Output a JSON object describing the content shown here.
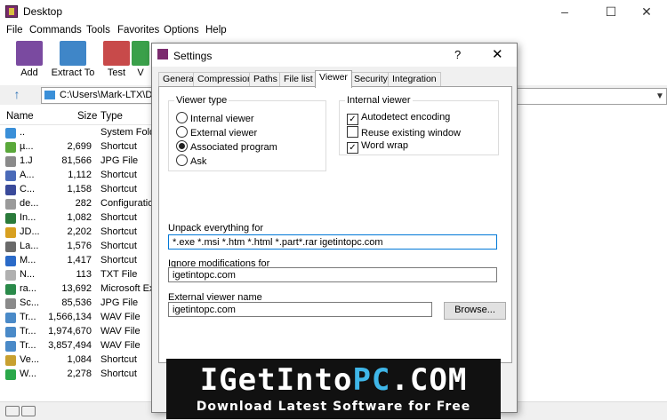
{
  "window": {
    "title": "Desktop",
    "controls": [
      "–",
      "☐",
      "✕"
    ]
  },
  "menu": [
    "File",
    "Commands",
    "Tools",
    "Favorites",
    "Options",
    "Help"
  ],
  "toolbar": [
    {
      "label": "Add",
      "color": "#7a4aa0"
    },
    {
      "label": "Extract To",
      "color": "#3f86c8"
    },
    {
      "label": "Test",
      "color": "#c84a4a"
    },
    {
      "label": "V",
      "color": "#3aa04a"
    }
  ],
  "path": {
    "value": "C:\\Users\\Mark-LTX\\Des"
  },
  "columns": [
    "Name",
    "Size",
    "Type"
  ],
  "files": [
    {
      "name": "..",
      "size": "",
      "type": "System Folde",
      "color": "#3a8fd8"
    },
    {
      "name": "µ...",
      "size": "2,699",
      "type": "Shortcut",
      "color": "#5aa83a"
    },
    {
      "name": "1.J",
      "size": "81,566",
      "type": "JPG File",
      "color": "#8a8a8a"
    },
    {
      "name": "A...",
      "size": "1,112",
      "type": "Shortcut",
      "color": "#4a6ab8"
    },
    {
      "name": "C...",
      "size": "1,158",
      "type": "Shortcut",
      "color": "#3a4a9a"
    },
    {
      "name": "de...",
      "size": "282",
      "type": "Configuration",
      "color": "#9a9a9a"
    },
    {
      "name": "In...",
      "size": "1,082",
      "type": "Shortcut",
      "color": "#2a7a3a"
    },
    {
      "name": "JD...",
      "size": "2,202",
      "type": "Shortcut",
      "color": "#d8a020"
    },
    {
      "name": "La...",
      "size": "1,576",
      "type": "Shortcut",
      "color": "#6a6a6a"
    },
    {
      "name": "M...",
      "size": "1,417",
      "type": "Shortcut",
      "color": "#2a6ac8"
    },
    {
      "name": "N...",
      "size": "113",
      "type": "TXT File",
      "color": "#b0b0b0"
    },
    {
      "name": "ra...",
      "size": "13,692",
      "type": "Microsoft Exc",
      "color": "#2a8a4a"
    },
    {
      "name": "Sc...",
      "size": "85,536",
      "type": "JPG File",
      "color": "#8a8a8a"
    },
    {
      "name": "Tr...",
      "size": "1,566,134",
      "type": "WAV File",
      "color": "#4a8ac8"
    },
    {
      "name": "Tr...",
      "size": "1,974,670",
      "type": "WAV File",
      "color": "#4a8ac8"
    },
    {
      "name": "Tr...",
      "size": "3,857,494",
      "type": "WAV File",
      "color": "#4a8ac8"
    },
    {
      "name": "Ve...",
      "size": "1,084",
      "type": "Shortcut",
      "color": "#c8a030"
    },
    {
      "name": "W...",
      "size": "2,278",
      "type": "Shortcut",
      "color": "#2aa84a"
    }
  ],
  "dialog": {
    "title": "Settings",
    "help": "?",
    "close": "✕",
    "tabs": [
      "General",
      "Compression",
      "Paths",
      "File list",
      "Viewer",
      "Security",
      "Integration"
    ],
    "active_tab": "Viewer",
    "viewer_type": {
      "label": "Viewer type",
      "options": [
        "Internal viewer",
        "External viewer",
        "Associated program",
        "Ask"
      ],
      "selected": "Associated program"
    },
    "internal_viewer": {
      "label": "Internal viewer",
      "options": [
        {
          "label": "Autodetect encoding",
          "checked": true
        },
        {
          "label": "Reuse existing window",
          "checked": false
        },
        {
          "label": "Word wrap",
          "checked": true
        }
      ]
    },
    "unpack": {
      "label": "Unpack everything for",
      "value": "*.exe *.msi *.htm *.html *.part*.rar igetintopc.com"
    },
    "ignore": {
      "label": "Ignore modifications for",
      "value": "igetintopc.com"
    },
    "external": {
      "label": "External viewer name",
      "value": "igetintopc.com",
      "browse": "Browse..."
    }
  },
  "banner": {
    "title_a": "IGetInto",
    "title_b": "PC",
    "title_c": ".COM",
    "subtitle": "Download Latest Software for Free"
  }
}
